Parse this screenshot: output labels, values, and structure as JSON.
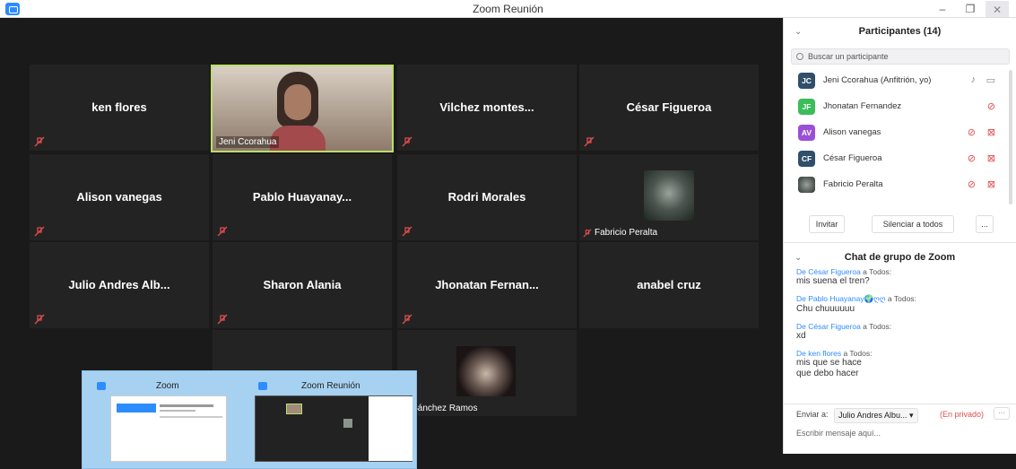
{
  "window": {
    "title": "Zoom Reunión"
  },
  "tiles": [
    {
      "name": "ken flores"
    },
    {
      "name": "Jeni Ccorahua",
      "video": true
    },
    {
      "name": "Vilchez montes..."
    },
    {
      "name": "César Figueroa"
    },
    {
      "name": "Alison vanegas"
    },
    {
      "name": "Pablo Huayanay..."
    },
    {
      "name": "Rodri Morales"
    },
    {
      "name": "Fabricio Peralta",
      "video": true
    },
    {
      "name": "Julio Andres Alb..."
    },
    {
      "name": "Sharon Alania"
    },
    {
      "name": "Jhonatan Fernan..."
    },
    {
      "name": "anabel cruz"
    },
    {
      "name": "bel Sánchez Ramos",
      "video": true
    }
  ],
  "taskbar_popup": {
    "thumb1_title": "Zoom",
    "thumb2_title": "Zoom Reunión"
  },
  "participants": {
    "title": "Participantes (14)",
    "search_placeholder": "Buscar un participante",
    "list": [
      {
        "initials": "JC",
        "name": "Jeni Ccorahua (Anfitrión, yo)",
        "color": "#2f4f6b"
      },
      {
        "initials": "JF",
        "name": "Jhonatan Fernandez",
        "color": "#3bbd5a"
      },
      {
        "initials": "AV",
        "name": "Alison vanegas",
        "color": "#9b4fd6"
      },
      {
        "initials": "CF",
        "name": "César Figueroa",
        "color": "#2f4f6b"
      },
      {
        "initials": "",
        "name": "Fabricio Peralta",
        "color": "#4a5a4a"
      }
    ],
    "invite": "Invitar",
    "mute_all": "Silenciar a todos",
    "more": "..."
  },
  "chat": {
    "title": "Chat de grupo de Zoom",
    "messages": [
      {
        "from": "De César Figueroa",
        "to": " a Todos:",
        "text": "mis suena el tren?"
      },
      {
        "from": "De Pablo Huayanay🌍ღღ",
        "to": " a Todos:",
        "text": "Chu chuuuuuu"
      },
      {
        "from": "De César Figueroa",
        "to": " a Todos:",
        "text": "xd"
      },
      {
        "from": "De ken flores",
        "to": " a Todos:",
        "text": "mis que se hace\nque debo hacer"
      }
    ],
    "send_to_label": "Enviar a:",
    "send_to_value": "Julio Andres Albu... ▾",
    "private": "(En privado)",
    "more": "···",
    "input_placeholder": "Escribir mensaje aquí..."
  }
}
